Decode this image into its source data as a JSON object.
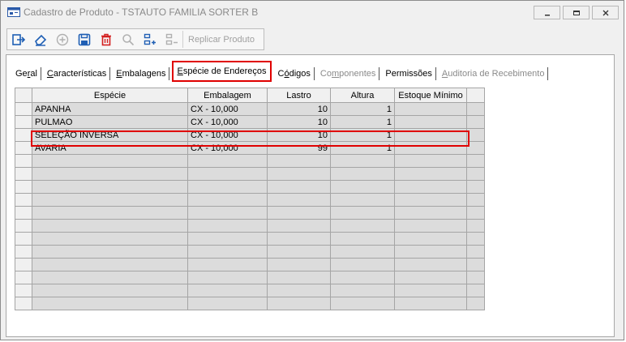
{
  "window": {
    "title": "Cadastro de Produto - TSTAUTO FAMILIA SORTER B"
  },
  "toolbar": {
    "replicar_label": "Replicar Produto"
  },
  "tabs": [
    {
      "label": "Geral",
      "state": "normal"
    },
    {
      "label": "Características",
      "state": "normal"
    },
    {
      "label": "Embalagens",
      "state": "normal"
    },
    {
      "label": "Espécie de Endereços",
      "state": "active"
    },
    {
      "label": "Códigos",
      "state": "normal"
    },
    {
      "label": "Componentes",
      "state": "disabled"
    },
    {
      "label": "Permissões",
      "state": "normal"
    },
    {
      "label": "Auditoria de Recebimento",
      "state": "disabled"
    }
  ],
  "grid": {
    "columns": [
      "Espécie",
      "Embalagem",
      "Lastro",
      "Altura",
      "Estoque Mínimo"
    ],
    "rows": [
      {
        "especie": "APANHA",
        "embalagem": "CX - 10,000",
        "lastro": "10",
        "altura": "1",
        "estoque": ""
      },
      {
        "especie": "PULMAO",
        "embalagem": "CX - 10,000",
        "lastro": "10",
        "altura": "1",
        "estoque": ""
      },
      {
        "especie": "SELEÇÃO INVERSA",
        "embalagem": "CX - 10,000",
        "lastro": "10",
        "altura": "1",
        "estoque": ""
      },
      {
        "especie": "AVARIA",
        "embalagem": "CX - 10,000",
        "lastro": "99",
        "altura": "1",
        "estoque": ""
      }
    ]
  },
  "colors": {
    "highlight": "#e00000",
    "grid_bg": "#dcdcdc"
  }
}
